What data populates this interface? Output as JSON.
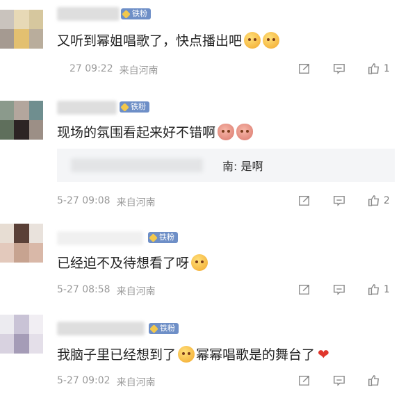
{
  "comments": [
    {
      "badge": "铁粉",
      "text": "又听到幂姐唱歌了，快点播出吧",
      "emojis": [
        "scream-face-emoji",
        "scream-face-emoji"
      ],
      "date": "27 09:22",
      "source": "来自河南",
      "likes": "1"
    },
    {
      "badge": "铁粉",
      "text": "现场的氛围看起来好不错啊",
      "emojis": [
        "pig-face-emoji",
        "pig-face-emoji"
      ],
      "reply": "南: 是啊",
      "date": "5-27 09:08",
      "source": "来自河南",
      "likes": "2"
    },
    {
      "badge": "铁粉",
      "text": "已经迫不及待想看了呀",
      "emojis": [
        "excited-face-emoji"
      ],
      "date": "5-27 08:58",
      "source": "来自河南",
      "likes": "1"
    },
    {
      "badge": "铁粉",
      "text": "我脑子里已经想到了",
      "text2": "幂幂唱歌是的舞台了",
      "emojis": [
        "grin-face-emoji",
        "heart-emoji"
      ],
      "date": "5-27 09:02",
      "source": "来自河南",
      "likes": ""
    }
  ],
  "colors": {
    "badge": "#6e8fc7",
    "meta": "#9a9a9a",
    "heart": "#e0362c"
  }
}
